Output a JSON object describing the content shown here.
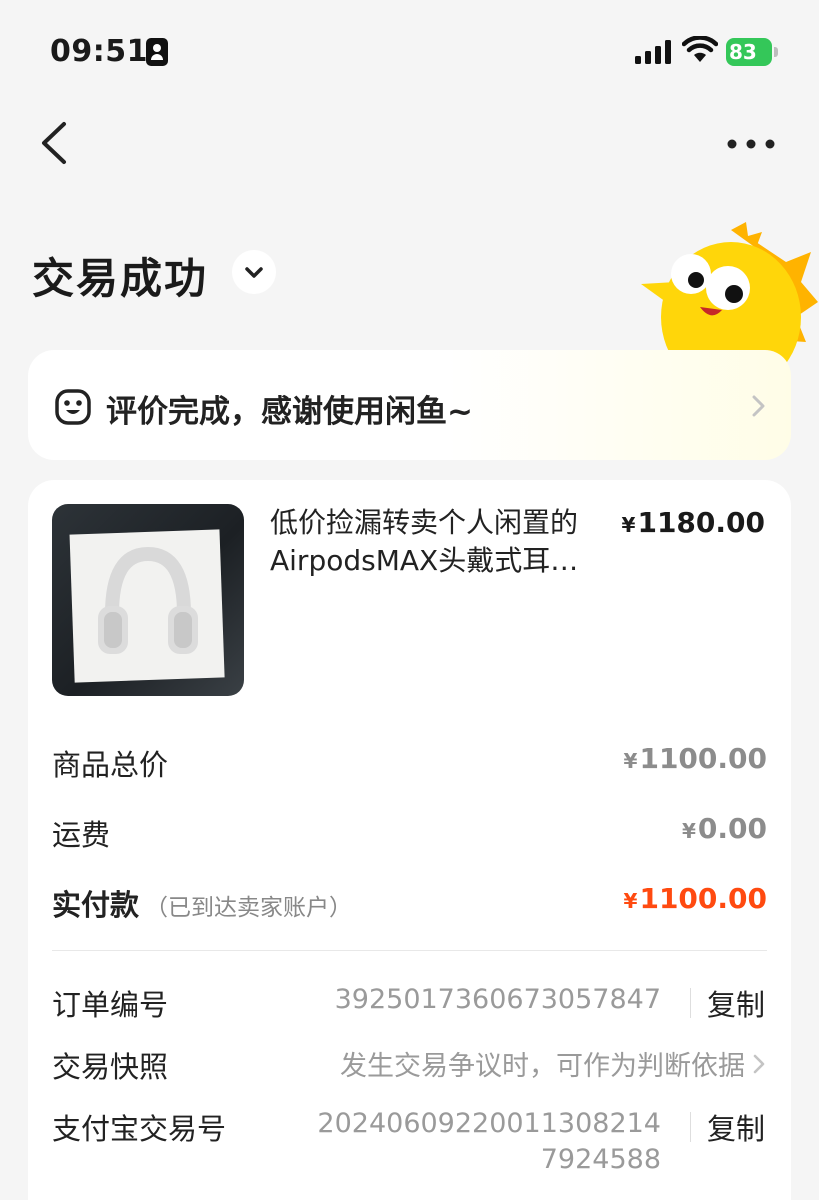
{
  "status_bar": {
    "time": "09:51",
    "battery": "83"
  },
  "order": {
    "status_title": "交易成功",
    "review_banner": "评价完成，感谢使用闲鱼~",
    "product": {
      "title_line1": "低价捡漏转卖个人闲置的",
      "title_line2": "AirpodsMAX头戴式耳…",
      "price_symbol": "¥",
      "price": "1180.00"
    },
    "summary": {
      "goods_total_label": "商品总价",
      "goods_total_symbol": "¥",
      "goods_total": "1100.00",
      "shipping_label": "运费",
      "shipping_symbol": "¥",
      "shipping": "0.00",
      "paid_label": "实付款",
      "paid_note": "（已到达卖家账户）",
      "paid_symbol": "¥",
      "paid": "1100.00"
    },
    "info": {
      "order_no_label": "订单编号",
      "order_no": "3925017360673057847",
      "copy_label": "复制",
      "snapshot_label": "交易快照",
      "snapshot_value": "发生交易争议时，可作为判断依据",
      "alipay_label": "支付宝交易号",
      "alipay_no_line1": "20240609220011308214",
      "alipay_no_line2": "7924588"
    }
  },
  "icons": {
    "back": "back-chevron-icon",
    "more": "more-dots-icon",
    "title_dropdown": "chevron-down-icon",
    "review": "face-icon",
    "review_arrow": "chevron-right-icon",
    "mascot": "fish-mascot"
  },
  "colors": {
    "accent_red": "#ff4a10",
    "battery_green": "#34c759",
    "mascot_yellow": "#ffd60a"
  }
}
